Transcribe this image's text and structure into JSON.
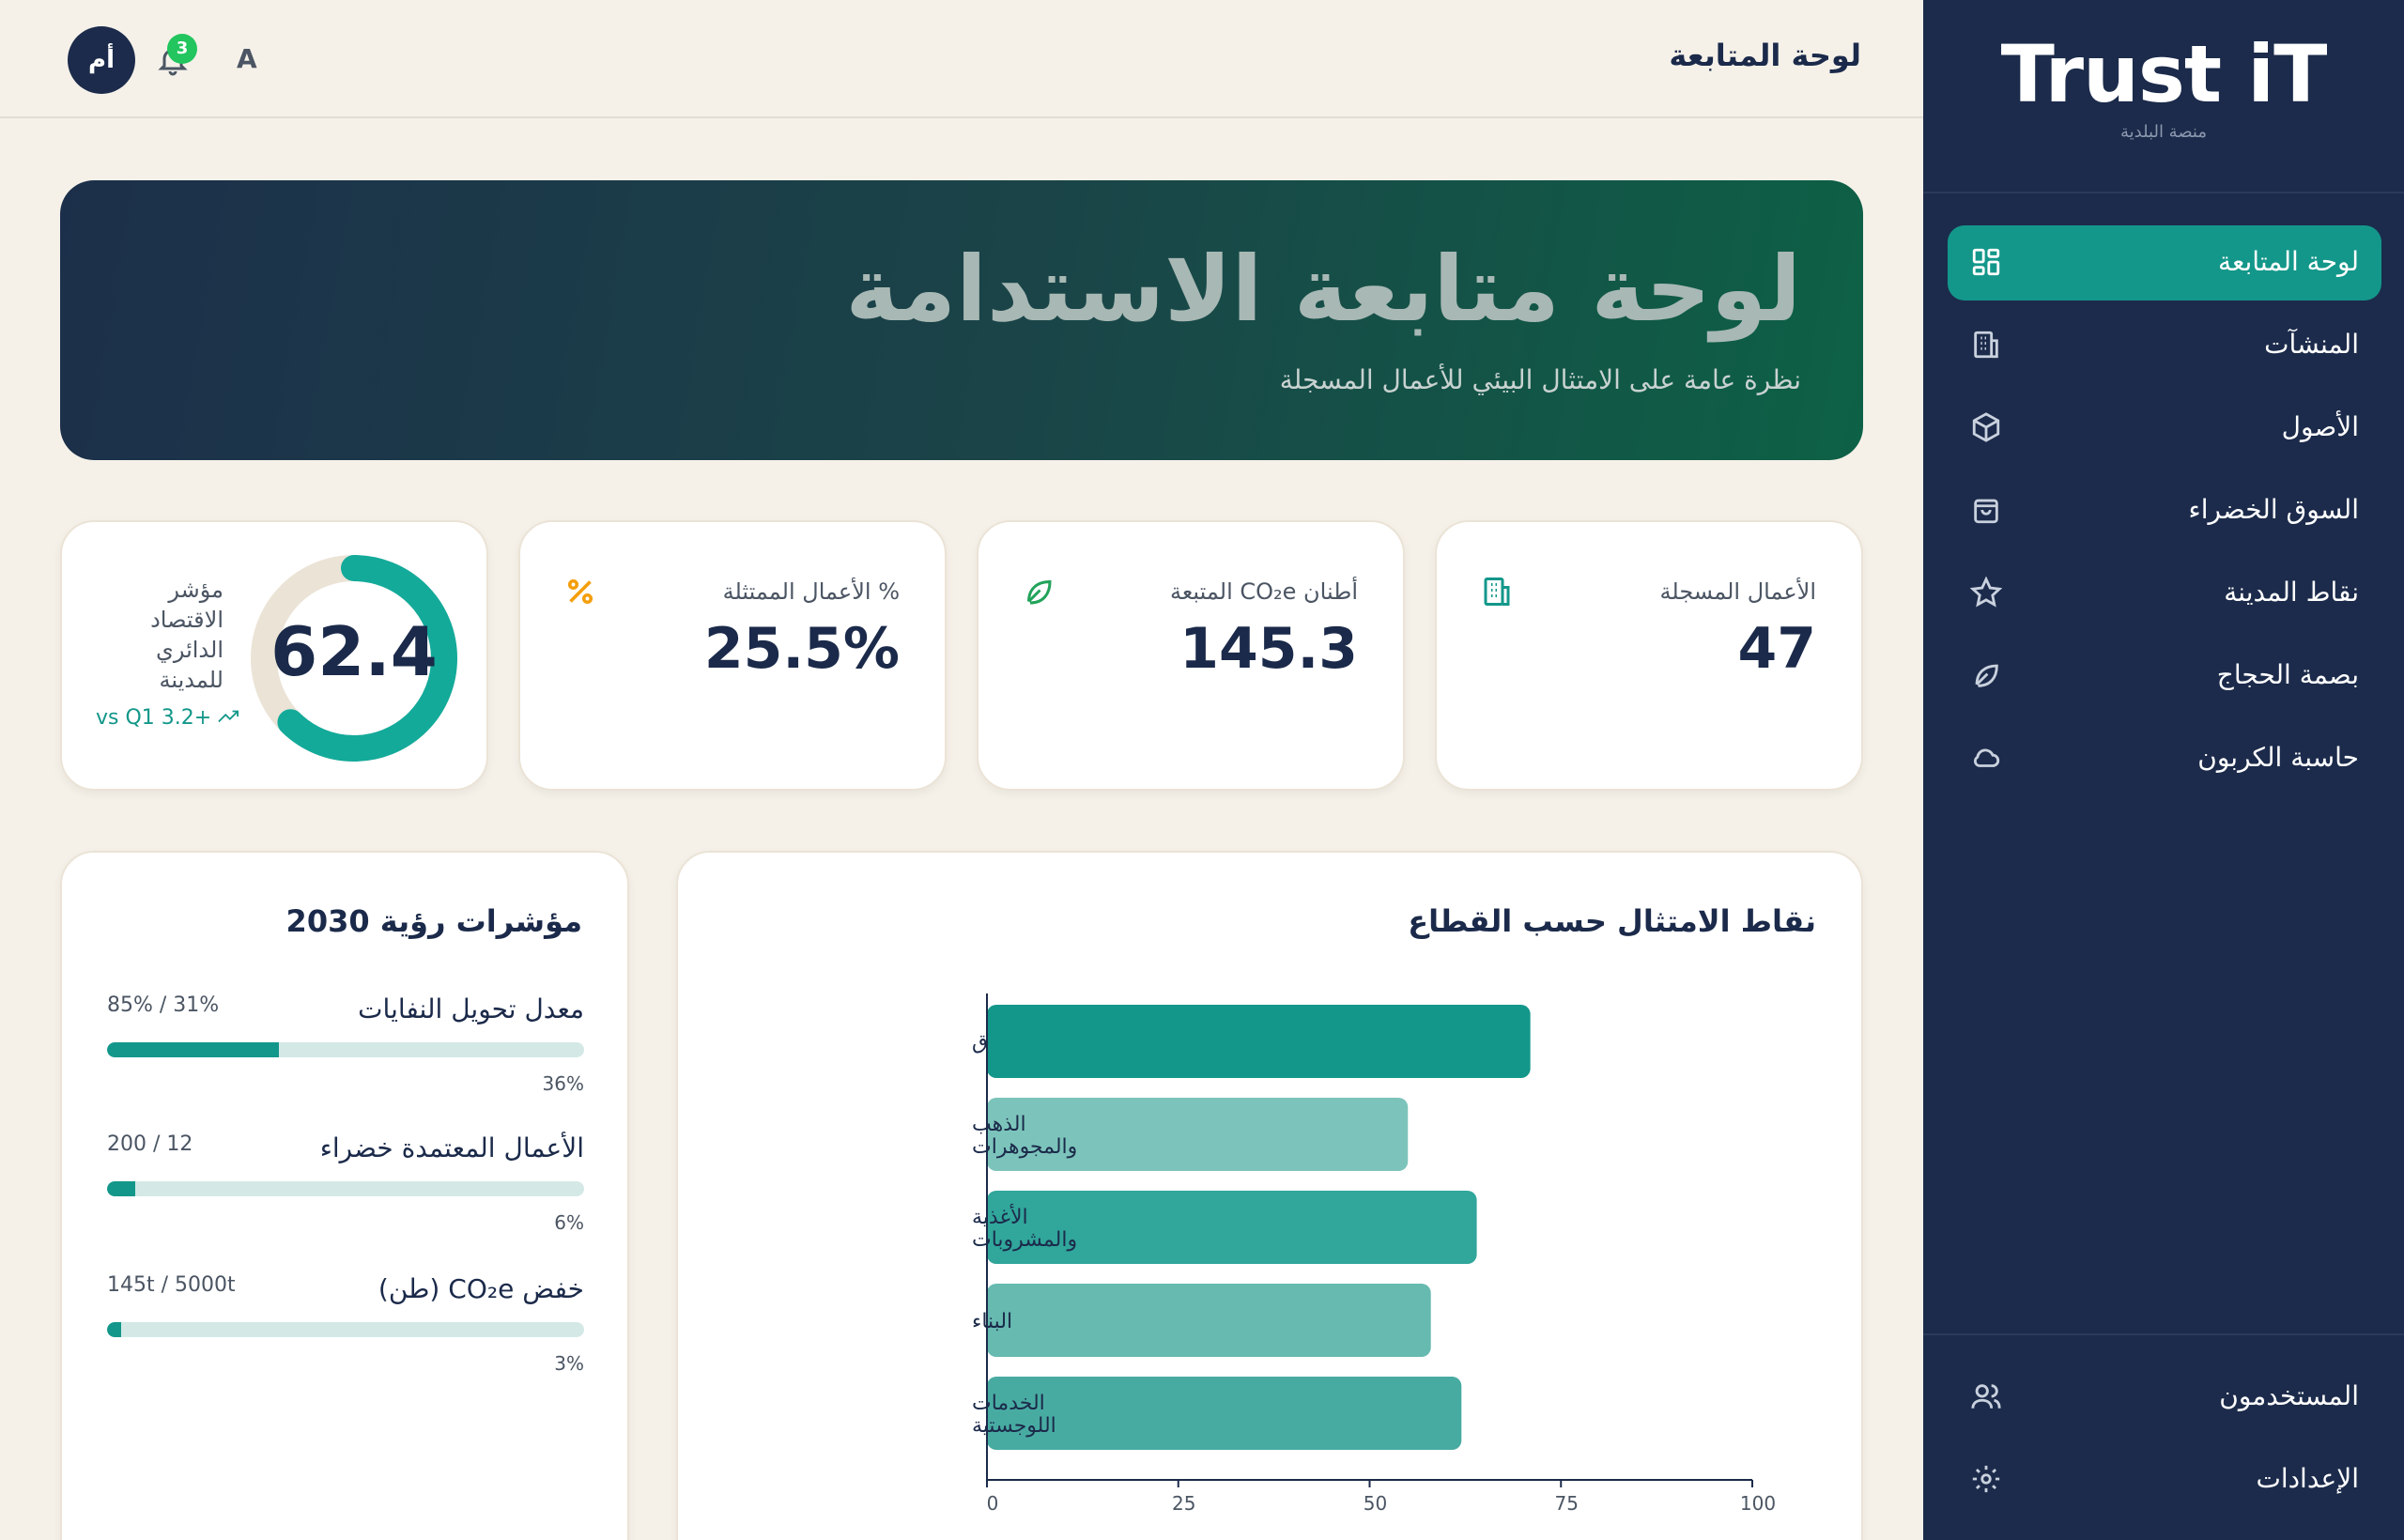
{
  "sidebar": {
    "brand": "Trust iT",
    "subtitle": "منصة البلدية",
    "items": [
      {
        "label": "لوحة المتابعة",
        "icon": "dashboard-icon",
        "active": true
      },
      {
        "label": "المنشآت",
        "icon": "building-icon",
        "active": false
      },
      {
        "label": "الأصول",
        "icon": "box-icon",
        "active": false
      },
      {
        "label": "السوق الخضراء",
        "icon": "shopping-bag-icon",
        "active": false
      },
      {
        "label": "نقاط المدينة",
        "icon": "star-icon",
        "active": false
      },
      {
        "label": "بصمة الحجاج",
        "icon": "leaf-icon",
        "active": false
      },
      {
        "label": "حاسبة الكربون",
        "icon": "cloud-icon",
        "active": false
      }
    ],
    "bottom_items": [
      {
        "label": "المستخدمون",
        "icon": "users-icon"
      },
      {
        "label": "الإعدادات",
        "icon": "settings-icon"
      }
    ]
  },
  "topbar": {
    "title": "لوحة المتابعة",
    "avatar_initials": "أم",
    "notification_count": "3",
    "lang_label": "A"
  },
  "hero": {
    "title": "لوحة متابعة الاستدامة",
    "subtitle": "نظرة عامة على الامتثال البيئي للأعمال المسجلة"
  },
  "stats": [
    {
      "label": "الأعمال المسجلة",
      "value": "47",
      "icon": "building-icon",
      "color": "#13978a"
    },
    {
      "label": "أطنان CO₂e المتبعة",
      "value": "145.3",
      "icon": "leaf-icon",
      "color": "#22a35a"
    },
    {
      "label": "% الأعمال الممتثلة",
      "value": "25.5%",
      "icon": "percent-icon",
      "color": "#f59e0b"
    }
  ],
  "circular_index": {
    "label": "مؤشر الاقتصاد الدائري للمدينة",
    "value": "62.4",
    "fraction": 0.624,
    "delta": "vs Q1 3.2+",
    "color": "#13aa9a",
    "track_color": "#ebe3d6"
  },
  "vision": {
    "title": "مؤشرات رؤية 2030",
    "kpis": [
      {
        "name": "معدل تحويل النفايات",
        "ratio": "85% / 31%",
        "pct": "36%",
        "fraction": 0.36
      },
      {
        "name": "الأعمال المعتمدة خضراء",
        "ratio": "200 / 12",
        "pct": "6%",
        "fraction": 0.06
      },
      {
        "name": "خفض CO₂e (طن)",
        "ratio": "145t / 5000t",
        "pct": "3%",
        "fraction": 0.03
      }
    ]
  },
  "chart_title": "نقاط الامتثال حسب القطاع",
  "chart_data": {
    "type": "bar",
    "orientation": "horizontal",
    "title": "نقاط الامتثال حسب القطاع",
    "categories": [
      "ق",
      "الذهب والمجوهرات",
      "الأغذية والمشروبات",
      "البناء",
      "الخدمات اللوجستية"
    ],
    "values": [
      71,
      55,
      64,
      58,
      62
    ],
    "colors": [
      "#13978a",
      "#7cc4bb",
      "#31a69b",
      "#66bab0",
      "#48aba2"
    ],
    "xlim": [
      0,
      100
    ],
    "ticks": [
      0,
      25,
      50,
      75,
      100
    ],
    "grid": false
  }
}
